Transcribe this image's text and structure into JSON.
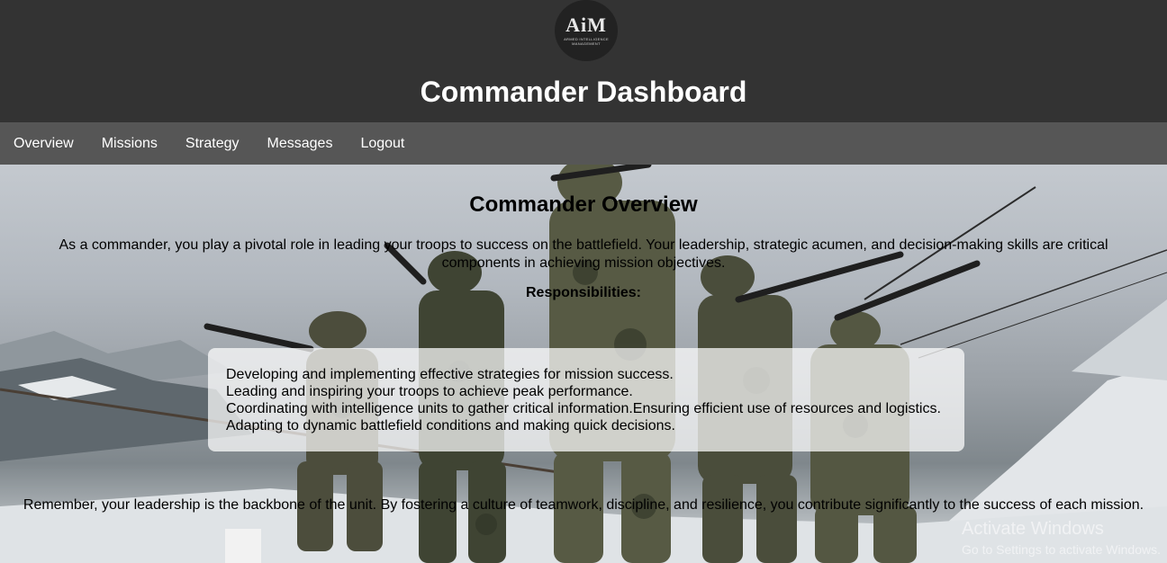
{
  "header": {
    "logo_text": "AiM",
    "logo_tagline": "ARMED INTELLIGENCE MANAGEMENT",
    "title": "Commander Dashboard"
  },
  "nav": {
    "items": [
      {
        "label": "Overview"
      },
      {
        "label": "Missions"
      },
      {
        "label": "Strategy"
      },
      {
        "label": "Messages"
      },
      {
        "label": "Logout"
      }
    ]
  },
  "main": {
    "title": "Commander Overview",
    "intro": "As a commander, you play a pivotal role in leading your troops to success on the battlefield. Your leadership, strategic acumen, and decision-making skills are critical components in achieving mission objectives.",
    "responsibilities_heading": "Responsibilities:",
    "responsibilities": [
      "Developing and implementing effective strategies for mission success.",
      "Leading and inspiring your troops to achieve peak performance.",
      "Coordinating with intelligence units to gather critical information.Ensuring efficient use of resources and logistics.",
      "Adapting to dynamic battlefield conditions and making quick decisions."
    ],
    "closing": "Remember, your leadership is the backbone of the unit. By fostering a culture of teamwork, discipline, and resilience, you contribute significantly to the success of each mission."
  },
  "watermark": {
    "line1": "Activate Windows",
    "line2": "Go to Settings to activate Windows."
  },
  "colors": {
    "header_bg": "#333333",
    "nav_bg": "#565656",
    "panel_bg": "rgba(255,255,255,0.72)"
  }
}
